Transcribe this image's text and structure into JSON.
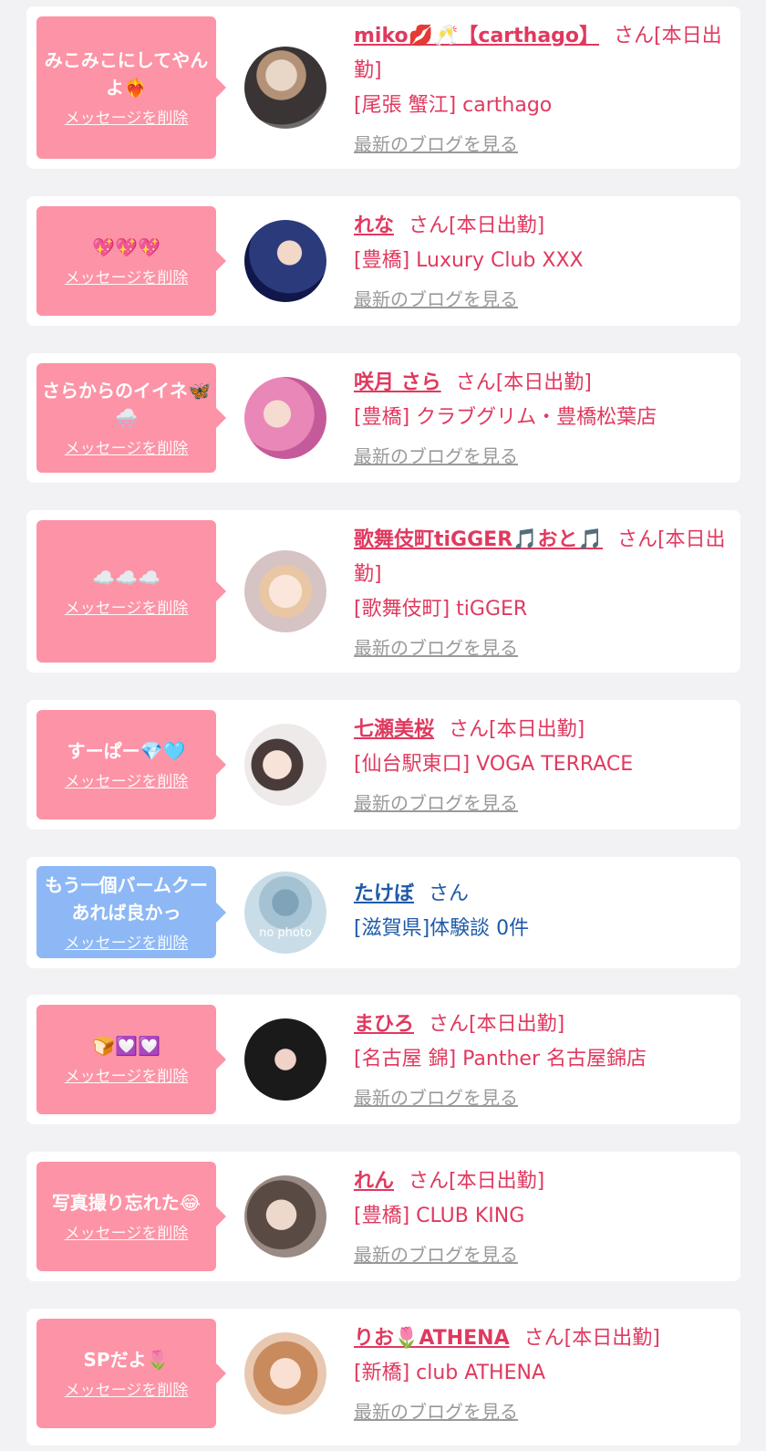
{
  "messages": [
    {
      "theme": "pink",
      "message": "みこみこにしてやんよ❤️‍🔥",
      "delete_label": "メッセージを削除",
      "name": "miko💋🥂【carthago】",
      "honorific": "さん",
      "status": "[本日出勤]",
      "shop": "[尾張 蟹江] carthago",
      "blog_label": "最新のブログを見る"
    },
    {
      "theme": "pink",
      "message": "💖💖💖",
      "delete_label": "メッセージを削除",
      "name": "れな",
      "honorific": "さん",
      "status": "[本日出勤]",
      "shop": "[豊橋] Luxury Club XXX",
      "blog_label": "最新のブログを見る"
    },
    {
      "theme": "pink",
      "message": "さらからのイイネ🦋🌨️",
      "delete_label": "メッセージを削除",
      "name": "咲月 さら",
      "honorific": "さん",
      "status": "[本日出勤]",
      "shop": "[豊橋] クラブグリム・豊橋松葉店",
      "blog_label": "最新のブログを見る"
    },
    {
      "theme": "pink",
      "message": "☁️☁️☁️",
      "delete_label": "メッセージを削除",
      "name": "歌舞伎町tiGGER🎵おと🎵",
      "honorific": "さん",
      "status": "[本日出勤]",
      "shop": "[歌舞伎町] tiGGER",
      "blog_label": "最新のブログを見る"
    },
    {
      "theme": "pink",
      "message": "すーぱー💎🩵",
      "delete_label": "メッセージを削除",
      "name": "七瀬美桜",
      "honorific": "さん",
      "status": "[本日出勤]",
      "shop": "[仙台駅東口] VOGA TERRACE",
      "blog_label": "最新のブログを見る"
    },
    {
      "theme": "blue",
      "message": "もう一個バームクーあれば良かっ",
      "delete_label": "メッセージを削除",
      "name": "たけぼ",
      "honorific": "さん",
      "status": "",
      "shop": "[滋賀県]体験談 0件",
      "blog_label": "",
      "avatar_text": "no photo"
    },
    {
      "theme": "pink",
      "message": "🍞💟💟",
      "delete_label": "メッセージを削除",
      "name": "まひろ",
      "honorific": "さん",
      "status": "[本日出勤]",
      "shop": "[名古屋 錦] Panther 名古屋錦店",
      "blog_label": "最新のブログを見る"
    },
    {
      "theme": "pink",
      "message": "写真撮り忘れた😂",
      "delete_label": "メッセージを削除",
      "name": "れん",
      "honorific": "さん",
      "status": "[本日出勤]",
      "shop": "[豊橋] CLUB KING",
      "blog_label": "最新のブログを見る"
    },
    {
      "theme": "pink",
      "message": "SPだよ🌷",
      "delete_label": "メッセージを削除",
      "name": "りお🌷ATHENA",
      "honorific": "さん",
      "status": "[本日出勤]",
      "shop": "[新橋] club ATHENA",
      "blog_label": "最新のブログを見る"
    }
  ],
  "colors": {
    "pink_bubble": "#fd93a6",
    "blue_bubble": "#8db8f5",
    "pink_text": "#e0395f",
    "blue_text": "#1e5aa8",
    "blog_link": "#9a9a9a",
    "background": "#f2f2f4"
  }
}
